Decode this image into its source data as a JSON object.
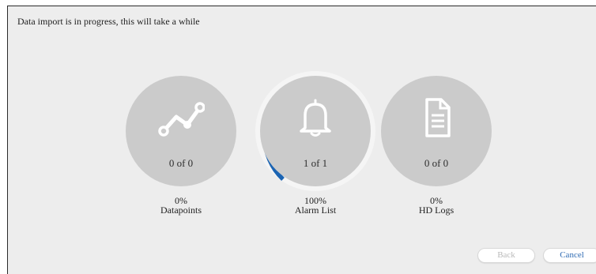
{
  "status_message": "Data import is in progress, this will take a while",
  "steps": [
    {
      "icon": "trend-line-icon",
      "count": "0 of 0",
      "percent": "0%",
      "label": "Datapoints",
      "progress": 0.0
    },
    {
      "icon": "bell-icon",
      "count": "1 of 1",
      "percent": "100%",
      "label": "Alarm List",
      "progress": 1.0
    },
    {
      "icon": "document-icon",
      "count": "0 of 0",
      "percent": "0%",
      "label": "HD Logs",
      "progress": 0.0
    }
  ],
  "buttons": {
    "back_label": "Back",
    "cancel_label": "Cancel"
  },
  "colors": {
    "progress_arc": "#1b64b3",
    "track": "#f5f5f5",
    "disc": "#cbcbcb",
    "cancel_text": "#2f6bb3",
    "back_text_disabled": "#b9b9b9"
  }
}
